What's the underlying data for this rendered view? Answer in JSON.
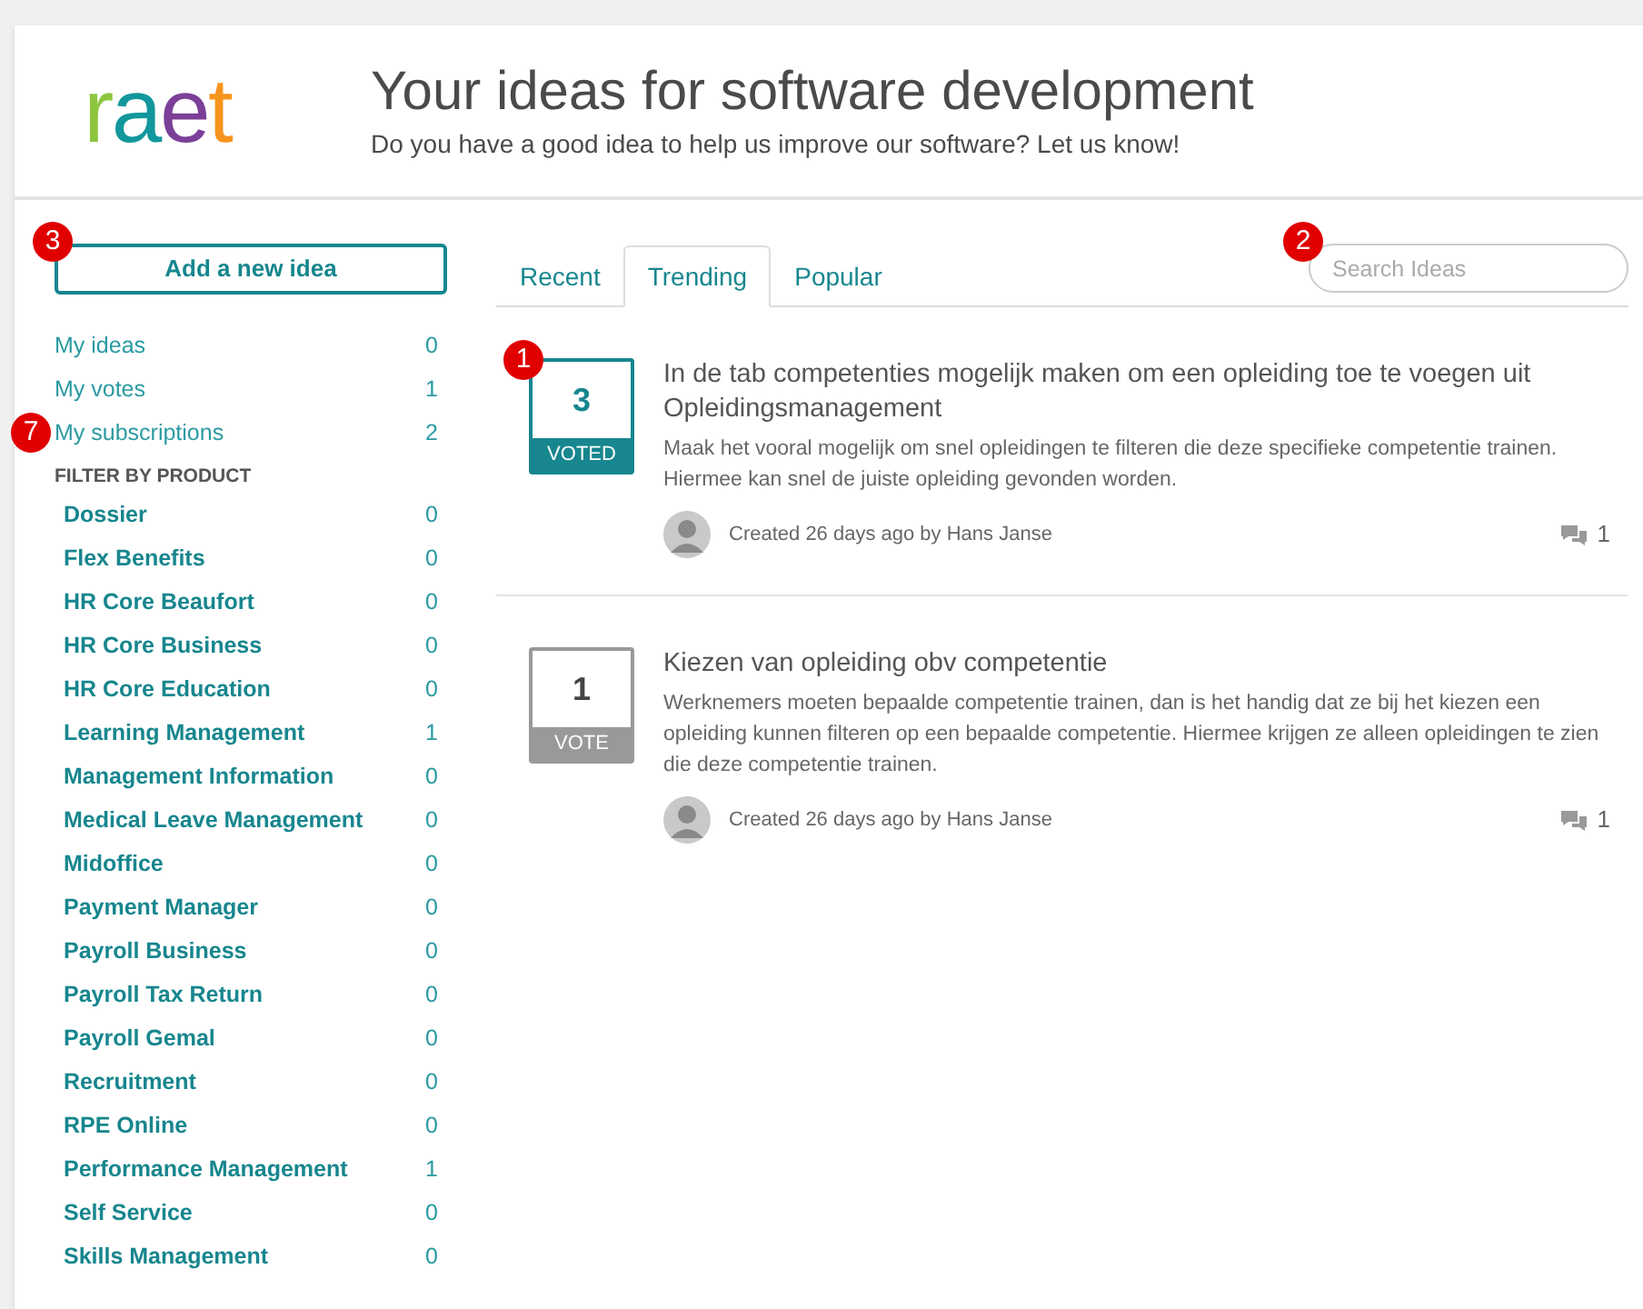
{
  "header": {
    "logo": "raet",
    "title": "Your ideas for software development",
    "subtitle": "Do you have a good idea to help us improve our software? Let us know!"
  },
  "sidebar": {
    "add_button": "Add a new idea",
    "add_callout": "3",
    "my_items": [
      {
        "label": "My ideas",
        "count": "0"
      },
      {
        "label": "My votes",
        "count": "1"
      },
      {
        "label": "My subscriptions",
        "count": "2",
        "callout": "7"
      }
    ],
    "filter_heading": "FILTER BY PRODUCT",
    "products": [
      {
        "label": "Dossier",
        "count": "0"
      },
      {
        "label": "Flex Benefits",
        "count": "0"
      },
      {
        "label": "HR Core Beaufort",
        "count": "0"
      },
      {
        "label": "HR Core Business",
        "count": "0"
      },
      {
        "label": "HR Core Education",
        "count": "0"
      },
      {
        "label": "Learning Management",
        "count": "1"
      },
      {
        "label": "Management Information",
        "count": "0"
      },
      {
        "label": "Medical Leave Management",
        "count": "0"
      },
      {
        "label": "Midoffice",
        "count": "0"
      },
      {
        "label": "Payment Manager",
        "count": "0"
      },
      {
        "label": "Payroll Business",
        "count": "0"
      },
      {
        "label": "Payroll Tax Return",
        "count": "0"
      },
      {
        "label": "Payroll Gemal",
        "count": "0"
      },
      {
        "label": "Recruitment",
        "count": "0"
      },
      {
        "label": "RPE Online",
        "count": "0"
      },
      {
        "label": "Performance Management",
        "count": "1"
      },
      {
        "label": "Self Service",
        "count": "0"
      },
      {
        "label": "Skills Management",
        "count": "0"
      }
    ]
  },
  "tabs": [
    {
      "label": "Recent",
      "selected": false
    },
    {
      "label": "Trending",
      "selected": true
    },
    {
      "label": "Popular",
      "selected": false
    }
  ],
  "search": {
    "placeholder": "Search Ideas",
    "callout": "2"
  },
  "ideas": [
    {
      "votes": "3",
      "vote_label": "VOTED",
      "voted": true,
      "callout": "1",
      "title": "In de tab competenties mogelijk maken om een opleiding toe te voegen uit Opleidingsmanagement",
      "description": "Maak het vooral mogelijk om snel opleidingen te filteren die deze specifieke competentie trainen. Hiermee kan snel de juiste opleiding gevonden worden.",
      "meta": "Created 26 days ago by Hans Janse",
      "comments": "1"
    },
    {
      "votes": "1",
      "vote_label": "VOTE",
      "voted": false,
      "title": "Kiezen van opleiding obv competentie",
      "description": "Werknemers moeten bepaalde competentie trainen, dan is het handig dat ze bij het kiezen een opleiding kunnen filteren op een bepaalde competentie. Hiermee krijgen ze alleen opleidingen te zien die deze competentie trainen.",
      "meta": "Created 26 days ago by Hans Janse",
      "comments": "1"
    }
  ]
}
